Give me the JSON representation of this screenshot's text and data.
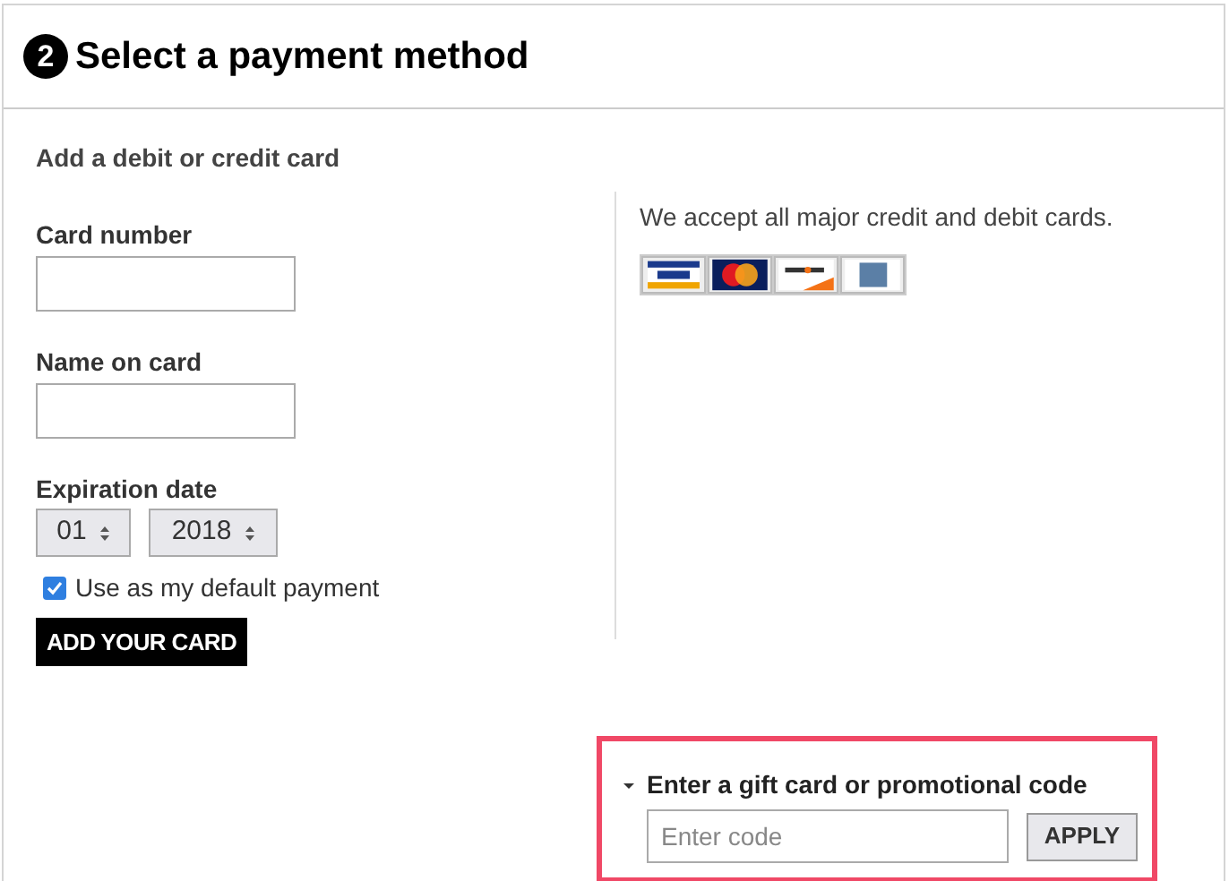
{
  "header": {
    "step": "2",
    "title": "Select a payment method"
  },
  "card_form": {
    "heading": "Add a debit or credit card",
    "fields": [
      {
        "label": "Card number"
      },
      {
        "label": "Name on card"
      }
    ],
    "expiration": {
      "label": "Expiration date",
      "month": "01",
      "year": "2018"
    },
    "default_payment": {
      "label": "Use as my default payment",
      "checked": true
    },
    "submit": "ADD YOUR CARD"
  },
  "accepted": {
    "text": "We accept all major credit and debit cards.",
    "cards": [
      {
        "kind": "visa"
      },
      {
        "kind": "mastercard"
      },
      {
        "kind": "discover"
      },
      {
        "kind": "amex"
      }
    ]
  },
  "promo": {
    "title": "Enter a gift card or promotional code",
    "expanded": true,
    "placeholder": "Enter code",
    "button": "APPLY"
  }
}
